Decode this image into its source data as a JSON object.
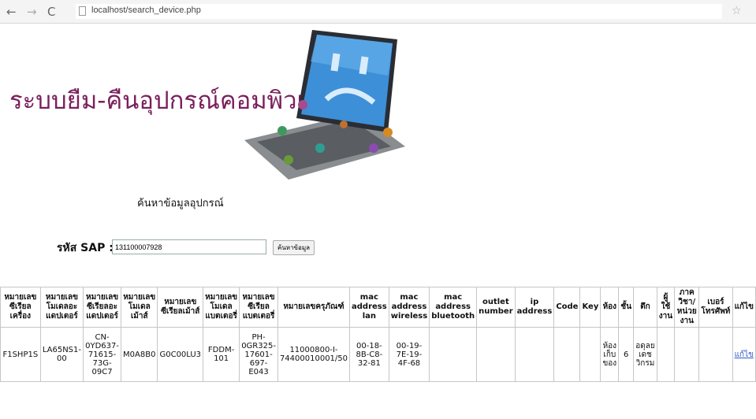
{
  "browser": {
    "url": "localhost/search_device.php"
  },
  "page": {
    "title": "ระบบยืม-คืนอุปกรณ์คอมพิวเตอร์",
    "subtitle": "ค้นหาข้อมูลอุปกรณ์"
  },
  "search": {
    "label": "รหัส SAP :",
    "value": "131100007928",
    "button_label": "ค้นหาข้อมูล"
  },
  "table": {
    "headers": [
      "หมายเลขซีเรียลเครื่อง",
      "หมายเลขโมเดลอะแดปเตอร์",
      "หมายเลขซีเรียลอะแดปเตอร์",
      "หมายเลขโมเดลเม้าส์",
      "หมายเลขซีเรียลเม้าส์",
      "หมายเลขโมเดลแบตเตอรี่",
      "หมายเลขซีเรียลแบตเตอรี่",
      "หมายเลขครุภัณฑ์",
      "mac address lan",
      "mac address wireless",
      "mac address bluetooth",
      "outlet number",
      "ip address",
      "Code",
      "Key",
      "ห้อง",
      "ชั้น",
      "ตึก",
      "ผู้ใช้งาน",
      "ภาควิชา/หน่วยงาน",
      "เบอร์โทรศัพท์",
      "แก้ไข"
    ],
    "rows": [
      [
        "F1SHP1S",
        "LA65NS1-00",
        "CN-0YD637-71615-73G-09C7",
        "M0A8B0",
        "G0C00LU3",
        "FDDM-101",
        "PH-0GR325-17601-697-E043",
        "11000800-I-74400010001/50",
        "00-18-8B-C8-32-81",
        "00-19-7E-19-4F-68",
        "",
        "",
        "",
        "",
        "",
        "ห้องเก็บของ",
        "6",
        "อดุลยเดชวิกรม",
        "",
        "",
        "",
        "แก้ไข"
      ]
    ]
  },
  "icons": {
    "back": "back-arrow-icon",
    "forward": "forward-arrow-icon",
    "reload": "reload-icon",
    "page": "document-icon",
    "bookmark": "star-icon"
  }
}
